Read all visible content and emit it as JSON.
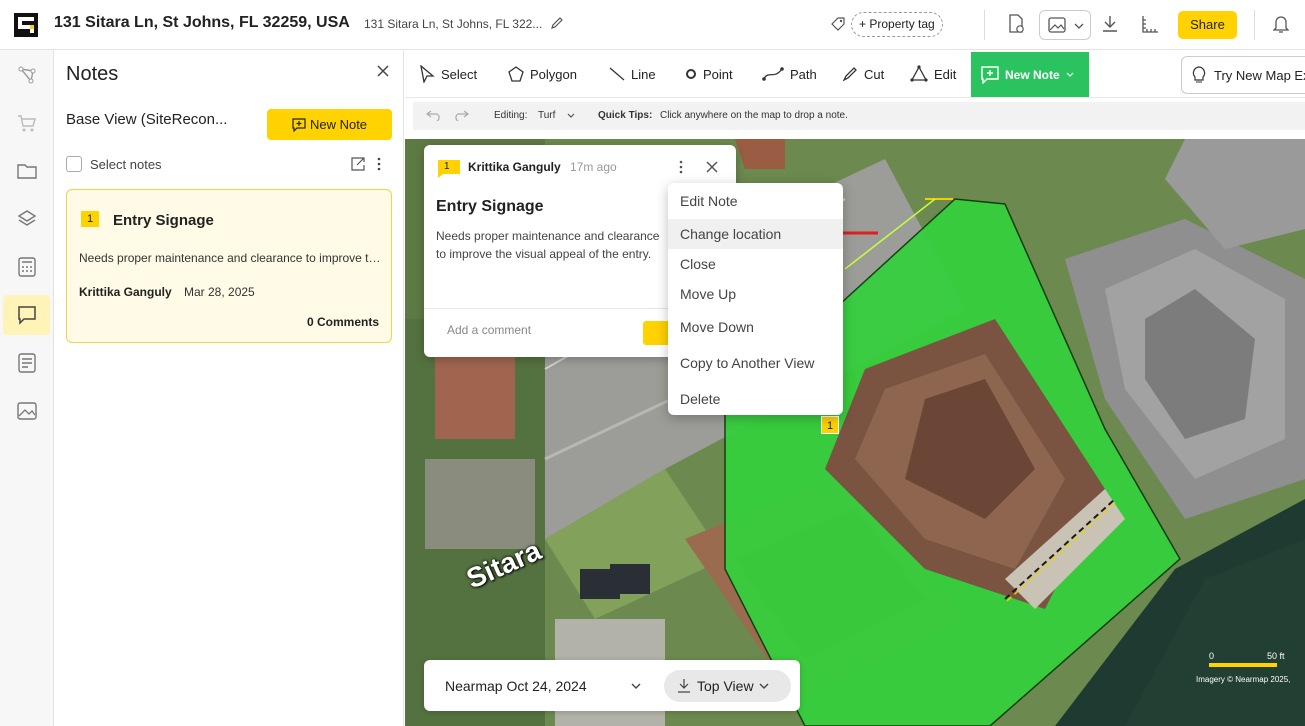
{
  "header": {
    "address": "131 Sitara Ln, St Johns, FL 32259, USA",
    "address_short": "131 Sitara Ln, St Johns, FL 322...",
    "property_tag": "+ Property tag",
    "share": "Share"
  },
  "rail": {
    "items": [
      "measure-icon",
      "cart-icon",
      "folder-icon",
      "layers-icon",
      "calculator-icon",
      "notes-icon",
      "document-icon",
      "image-icon"
    ],
    "active": "notes-icon"
  },
  "notes_panel": {
    "title": "Notes",
    "base_view": "Base View (SiteRecon...",
    "new_note": "New Note",
    "select_notes": "Select notes",
    "cards": [
      {
        "number": "1",
        "title": "Entry Signage",
        "body": "Needs proper maintenance and clearance to improve the visual appeal of the entry.",
        "author": "Krittika Ganguly",
        "date": "Mar 28, 2025",
        "comments": "0 Comments"
      }
    ]
  },
  "toolbar": {
    "tools": [
      "Select",
      "Polygon",
      "Line",
      "Point",
      "Path",
      "Cut",
      "Edit"
    ],
    "new_note": "New Note",
    "try_map": "Try New Map Ex"
  },
  "subbar": {
    "editing_label": "Editing:",
    "editing_value": "Turf",
    "tips_label": "Quick Tips:",
    "tips_text": "Click anywhere on the map to drop a note."
  },
  "popup": {
    "number": "1",
    "author": "Krittika Ganguly",
    "time": "17m ago",
    "title": "Entry Signage",
    "body": "Needs proper maintenance and clearance to improve the visual appeal of the entry.",
    "comment_placeholder": "Add a comment"
  },
  "menu": {
    "items": [
      "Edit Note",
      "Change location",
      "Close",
      "Move Up",
      "Move Down",
      "Copy to Another View",
      "Delete"
    ],
    "highlighted": "Change location"
  },
  "map": {
    "street_label": "Sitara",
    "pin_number": "1",
    "date": "Nearmap Oct 24, 2024",
    "view": "Top View",
    "scale_start": "0",
    "scale_end": "50 ft",
    "credit": "Imagery © Nearmap 2025,"
  },
  "colors": {
    "accent_yellow": "#FFD200",
    "active_green": "#2BC260",
    "annotation_red": "#E0201B"
  }
}
